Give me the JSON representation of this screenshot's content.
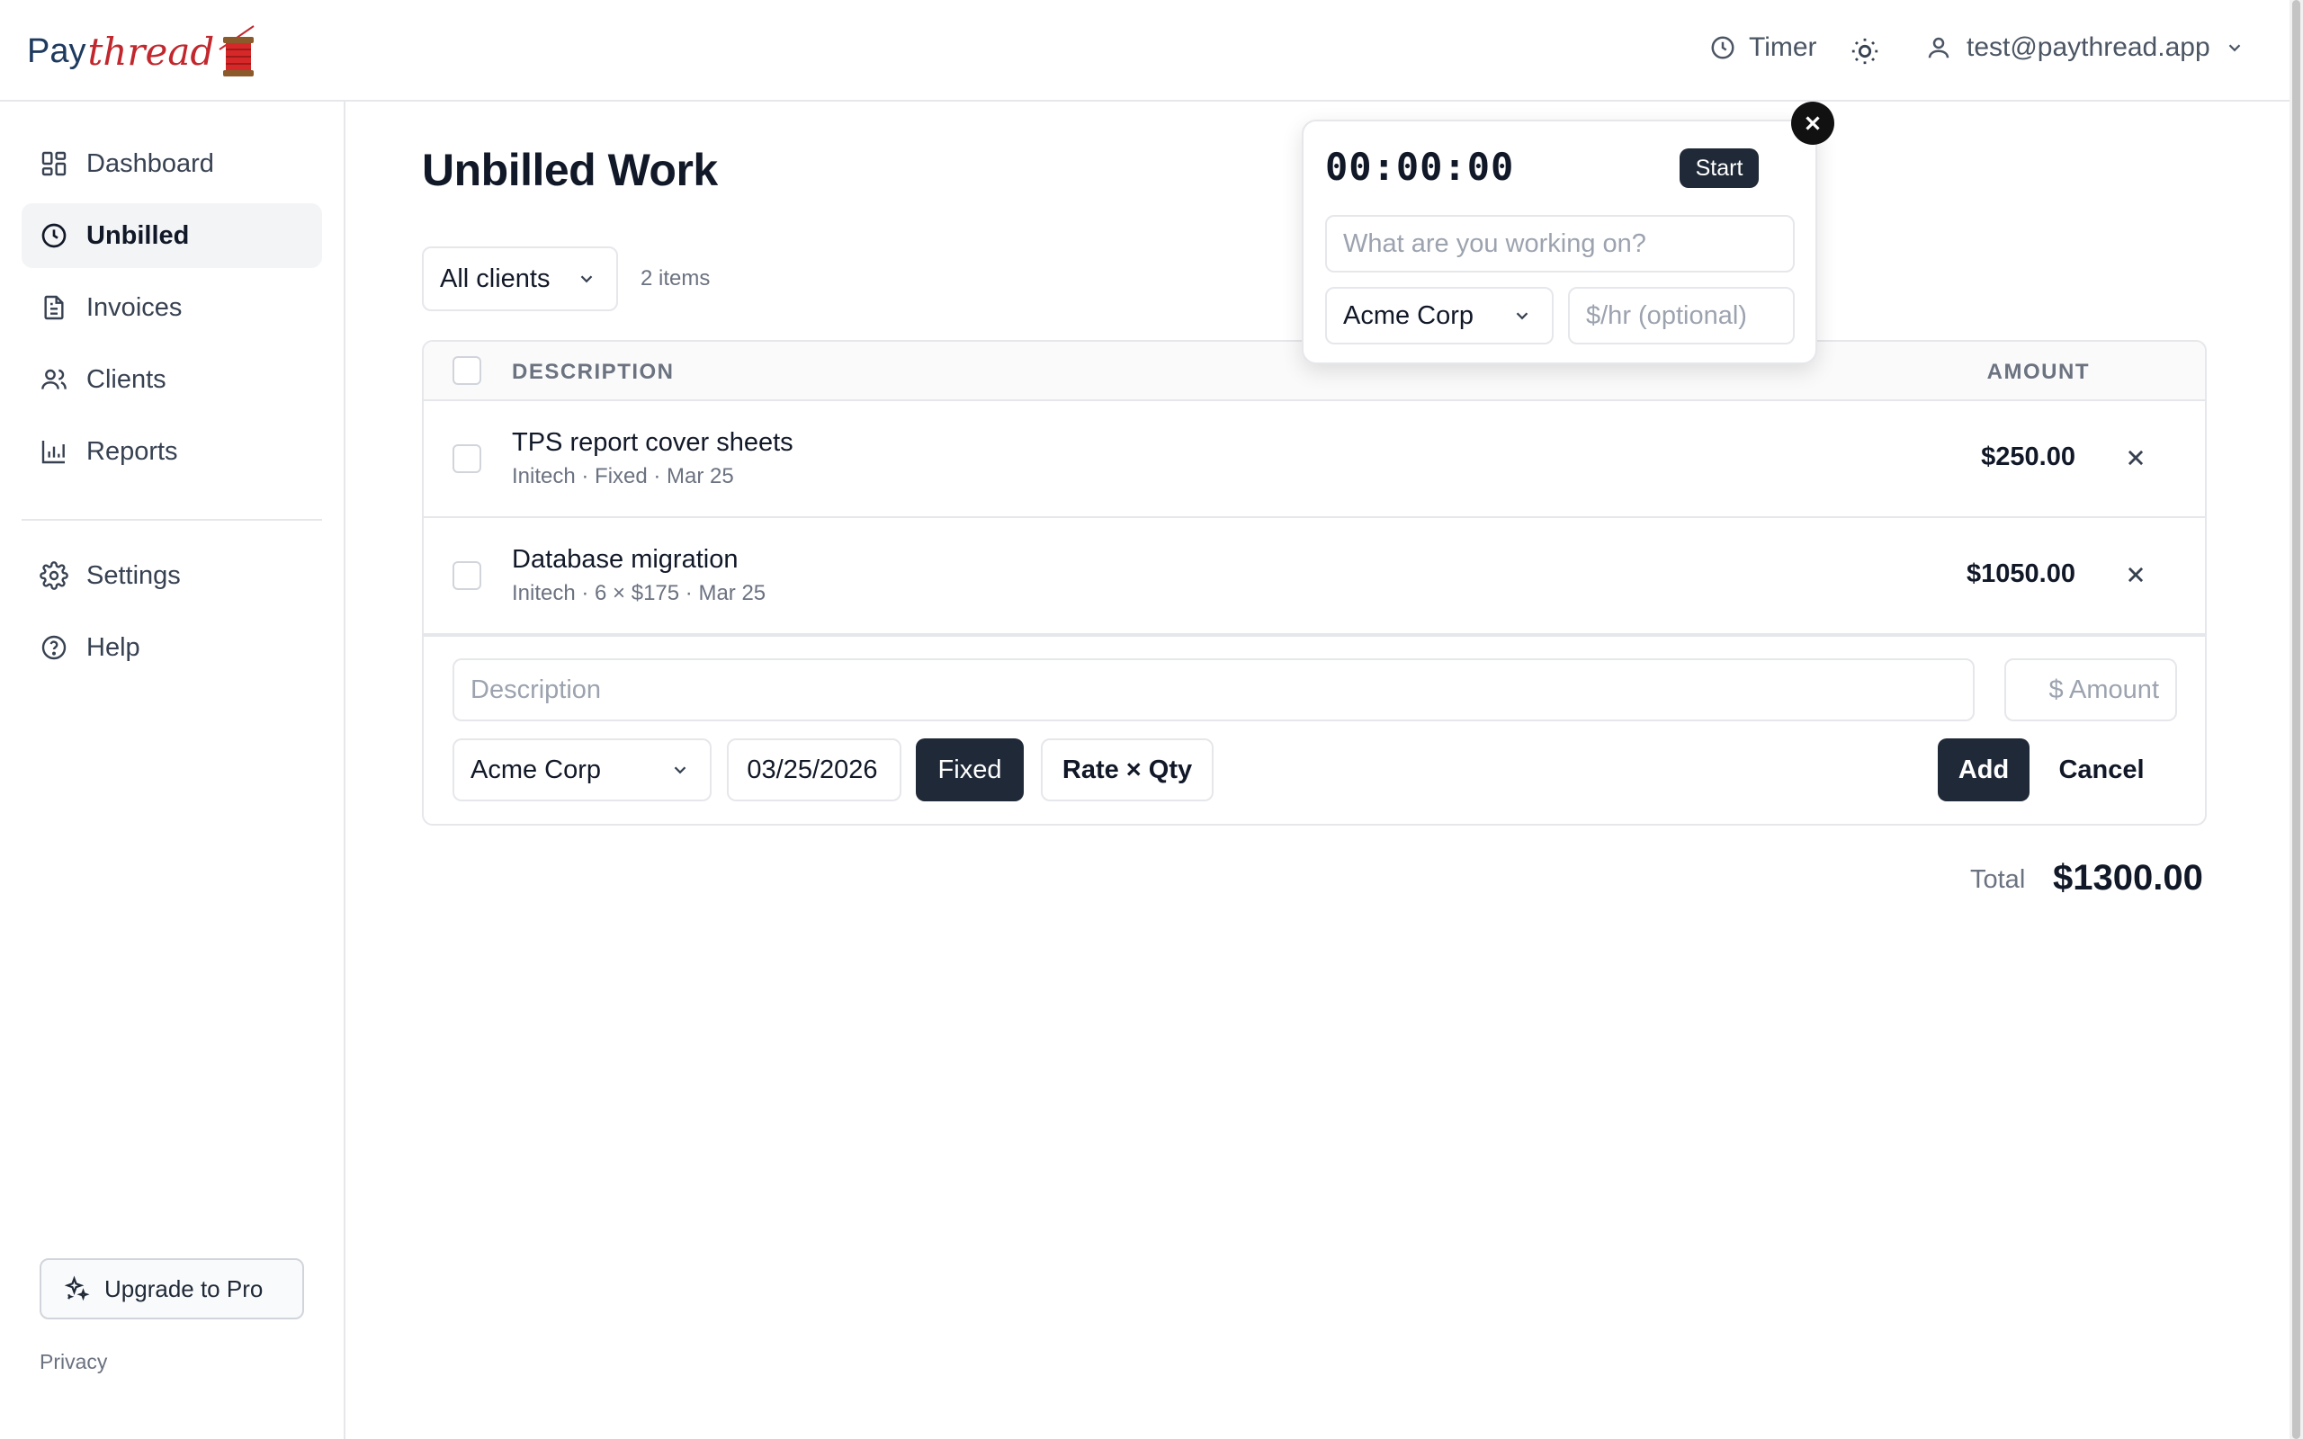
{
  "brand": {
    "name_part1": "Pay",
    "name_part2": "thread"
  },
  "topbar": {
    "timer_label": "Timer",
    "user_email": "test@paythread.app"
  },
  "sidebar": {
    "items": [
      {
        "label": "Dashboard",
        "icon": "dashboard-icon",
        "active": false
      },
      {
        "label": "Unbilled",
        "icon": "clock-icon",
        "active": true
      },
      {
        "label": "Invoices",
        "icon": "document-icon",
        "active": false
      },
      {
        "label": "Clients",
        "icon": "users-icon",
        "active": false
      },
      {
        "label": "Reports",
        "icon": "bar-chart-icon",
        "active": false
      },
      {
        "label": "Settings",
        "icon": "gear-icon",
        "active": false
      },
      {
        "label": "Help",
        "icon": "help-icon",
        "active": false
      }
    ],
    "upgrade_label": "Upgrade to Pro",
    "privacy_label": "Privacy"
  },
  "main": {
    "title": "Unbilled Work",
    "client_filter": "All clients",
    "items_count": "2 items",
    "table": {
      "col_description": "DESCRIPTION",
      "col_amount": "AMOUNT",
      "rows": [
        {
          "title": "TPS report cover sheets",
          "meta": "Initech · Fixed · Mar 25",
          "amount": "$250.00"
        },
        {
          "title": "Database migration",
          "meta": "Initech · 6 × $175 · Mar 25",
          "amount": "$1050.00"
        }
      ]
    },
    "add_form": {
      "description_placeholder": "Description",
      "amount_placeholder": "$ Amount",
      "client": "Acme Corp",
      "date": "03/25/2026",
      "fixed_label": "Fixed",
      "rate_qty_label": "Rate × Qty",
      "add_label": "Add",
      "cancel_label": "Cancel"
    },
    "total_label": "Total",
    "total_value": "$1300.00"
  },
  "timer_popover": {
    "elapsed": "00:00:00",
    "start_label": "Start",
    "task_placeholder": "What are you working on?",
    "client": "Acme Corp",
    "rate_placeholder": "$/hr (optional)"
  },
  "colors": {
    "primary_dark": "#1f2937",
    "brand_blue": "#1e3a5f",
    "brand_red": "#c1272d",
    "border": "#e5e7eb",
    "muted_text": "#6b7280"
  }
}
